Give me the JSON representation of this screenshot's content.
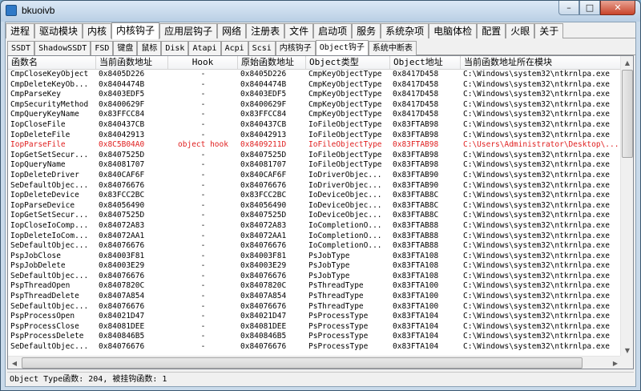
{
  "window": {
    "title": "bkuoivb",
    "minimize": "–",
    "maximize": "□",
    "close": "✕"
  },
  "main_tabs": [
    {
      "label": "进程",
      "active": false
    },
    {
      "label": "驱动模块",
      "active": false
    },
    {
      "label": "内核",
      "active": false
    },
    {
      "label": "内核钩子",
      "active": true
    },
    {
      "label": "应用层钩子",
      "active": false
    },
    {
      "label": "网络",
      "active": false
    },
    {
      "label": "注册表",
      "active": false
    },
    {
      "label": "文件",
      "active": false
    },
    {
      "label": "启动项",
      "active": false
    },
    {
      "label": "服务",
      "active": false
    },
    {
      "label": "系统杂项",
      "active": false
    },
    {
      "label": "电脑体检",
      "active": false
    },
    {
      "label": "配置",
      "active": false
    },
    {
      "label": "火眼",
      "active": false
    },
    {
      "label": "关于",
      "active": false
    }
  ],
  "sub_tabs": [
    {
      "label": "SSDT",
      "active": false
    },
    {
      "label": "ShadowSSDT",
      "active": false
    },
    {
      "label": "FSD",
      "active": false
    },
    {
      "label": "键盘",
      "active": false
    },
    {
      "label": "鼠标",
      "active": false
    },
    {
      "label": "Disk",
      "active": false
    },
    {
      "label": "Atapi",
      "active": false
    },
    {
      "label": "Acpi",
      "active": false
    },
    {
      "label": "Scsi",
      "active": false
    },
    {
      "label": "内核钩子",
      "active": false
    },
    {
      "label": "Object钩子",
      "active": true
    },
    {
      "label": "系统中断表",
      "active": false
    }
  ],
  "columns": [
    "函数名",
    "当前函数地址",
    "Hook",
    "原始函数地址",
    "Object类型",
    "Object地址",
    "当前函数地址所在模块"
  ],
  "rows": [
    {
      "name": "CmpCloseKeyObject",
      "cur": "0x8405D226",
      "hook": "-",
      "orig": "0x8405D226",
      "type": "CmpKeyObjectType",
      "addr": "0x8417D458",
      "module": "C:\\Windows\\system32\\ntkrnlpa.exe",
      "hooked": false
    },
    {
      "name": "CmpDeleteKeyOb...",
      "cur": "0x8404474B",
      "hook": "-",
      "orig": "0x8404474B",
      "type": "CmpKeyObjectType",
      "addr": "0x8417D458",
      "module": "C:\\Windows\\system32\\ntkrnlpa.exe",
      "hooked": false
    },
    {
      "name": "CmpParseKey",
      "cur": "0x8403EDF5",
      "hook": "-",
      "orig": "0x8403EDF5",
      "type": "CmpKeyObjectType",
      "addr": "0x8417D458",
      "module": "C:\\Windows\\system32\\ntkrnlpa.exe",
      "hooked": false
    },
    {
      "name": "CmpSecurityMethod",
      "cur": "0x8400629F",
      "hook": "-",
      "orig": "0x8400629F",
      "type": "CmpKeyObjectType",
      "addr": "0x8417D458",
      "module": "C:\\Windows\\system32\\ntkrnlpa.exe",
      "hooked": false
    },
    {
      "name": "CmpQueryKeyName",
      "cur": "0x83FFCC84",
      "hook": "-",
      "orig": "0x83FFCC84",
      "type": "CmpKeyObjectType",
      "addr": "0x8417D458",
      "module": "C:\\Windows\\system32\\ntkrnlpa.exe",
      "hooked": false
    },
    {
      "name": "IopCloseFile",
      "cur": "0x840437CB",
      "hook": "-",
      "orig": "0x840437CB",
      "type": "IoFileObjectType",
      "addr": "0x83FTAB98",
      "module": "C:\\Windows\\system32\\ntkrnlpa.exe",
      "hooked": false
    },
    {
      "name": "IopDeleteFile",
      "cur": "0x84042913",
      "hook": "-",
      "orig": "0x84042913",
      "type": "IoFileObjectType",
      "addr": "0x83FTAB98",
      "module": "C:\\Windows\\system32\\ntkrnlpa.exe",
      "hooked": false
    },
    {
      "name": "IopParseFile",
      "cur": "0x8C5B04A0",
      "hook": "object hook",
      "orig": "0x8409211D",
      "type": "IoFileObjectType",
      "addr": "0x83FTAB98",
      "module": "C:\\Users\\Administrator\\Desktop\\...",
      "hooked": true
    },
    {
      "name": "IopGetSetSecur...",
      "cur": "0x8407525D",
      "hook": "-",
      "orig": "0x8407525D",
      "type": "IoFileObjectType",
      "addr": "0x83FTAB98",
      "module": "C:\\Windows\\system32\\ntkrnlpa.exe",
      "hooked": false
    },
    {
      "name": "IopQueryName",
      "cur": "0x84081707",
      "hook": "-",
      "orig": "0x84081707",
      "type": "IoFileObjectType",
      "addr": "0x83FTAB98",
      "module": "C:\\Windows\\system32\\ntkrnlpa.exe",
      "hooked": false
    },
    {
      "name": "IopDeleteDriver",
      "cur": "0x840CAF6F",
      "hook": "-",
      "orig": "0x840CAF6F",
      "type": "IoDriverObjec...",
      "addr": "0x83FTAB90",
      "module": "C:\\Windows\\system32\\ntkrnlpa.exe",
      "hooked": false
    },
    {
      "name": "SeDefaultObjec...",
      "cur": "0x84076676",
      "hook": "-",
      "orig": "0x84076676",
      "type": "IoDriverObjec...",
      "addr": "0x83FTAB90",
      "module": "C:\\Windows\\system32\\ntkrnlpa.exe",
      "hooked": false
    },
    {
      "name": "IopDeleteDevice",
      "cur": "0x83FCC2BC",
      "hook": "-",
      "orig": "0x83FCC2BC",
      "type": "IoDeviceObjec...",
      "addr": "0x83FTAB8C",
      "module": "C:\\Windows\\system32\\ntkrnlpa.exe",
      "hooked": false
    },
    {
      "name": "IopParseDevice",
      "cur": "0x84056490",
      "hook": "-",
      "orig": "0x84056490",
      "type": "IoDeviceObjec...",
      "addr": "0x83FTAB8C",
      "module": "C:\\Windows\\system32\\ntkrnlpa.exe",
      "hooked": false
    },
    {
      "name": "IopGetSetSecur...",
      "cur": "0x8407525D",
      "hook": "-",
      "orig": "0x8407525D",
      "type": "IoDeviceObjec...",
      "addr": "0x83FTAB8C",
      "module": "C:\\Windows\\system32\\ntkrnlpa.exe",
      "hooked": false
    },
    {
      "name": "IopCloseIoComp...",
      "cur": "0x84072A83",
      "hook": "-",
      "orig": "0x84072A83",
      "type": "IoCompletionO...",
      "addr": "0x83FTAB88",
      "module": "C:\\Windows\\system32\\ntkrnlpa.exe",
      "hooked": false
    },
    {
      "name": "IopDeleteIoCom...",
      "cur": "0x84072AA1",
      "hook": "-",
      "orig": "0x84072AA1",
      "type": "IoCompletionO...",
      "addr": "0x83FTAB88",
      "module": "C:\\Windows\\system32\\ntkrnlpa.exe",
      "hooked": false
    },
    {
      "name": "SeDefaultObjec...",
      "cur": "0x84076676",
      "hook": "-",
      "orig": "0x84076676",
      "type": "IoCompletionO...",
      "addr": "0x83FTAB88",
      "module": "C:\\Windows\\system32\\ntkrnlpa.exe",
      "hooked": false
    },
    {
      "name": "PspJobClose",
      "cur": "0x84003F81",
      "hook": "-",
      "orig": "0x84003F81",
      "type": "PsJobType",
      "addr": "0x83FTA108",
      "module": "C:\\Windows\\system32\\ntkrnlpa.exe",
      "hooked": false
    },
    {
      "name": "PspJobDelete",
      "cur": "0x84003E29",
      "hook": "-",
      "orig": "0x84003E29",
      "type": "PsJobType",
      "addr": "0x83FTA108",
      "module": "C:\\Windows\\system32\\ntkrnlpa.exe",
      "hooked": false
    },
    {
      "name": "SeDefaultObjec...",
      "cur": "0x84076676",
      "hook": "-",
      "orig": "0x84076676",
      "type": "PsJobType",
      "addr": "0x83FTA108",
      "module": "C:\\Windows\\system32\\ntkrnlpa.exe",
      "hooked": false
    },
    {
      "name": "PspThreadOpen",
      "cur": "0x8407820C",
      "hook": "-",
      "orig": "0x8407820C",
      "type": "PsThreadType",
      "addr": "0x83FTA100",
      "module": "C:\\Windows\\system32\\ntkrnlpa.exe",
      "hooked": false
    },
    {
      "name": "PspThreadDelete",
      "cur": "0x8407A854",
      "hook": "-",
      "orig": "0x8407A854",
      "type": "PsThreadType",
      "addr": "0x83FTA100",
      "module": "C:\\Windows\\system32\\ntkrnlpa.exe",
      "hooked": false
    },
    {
      "name": "SeDefaultObjec...",
      "cur": "0x84076676",
      "hook": "-",
      "orig": "0x84076676",
      "type": "PsThreadType",
      "addr": "0x83FTA100",
      "module": "C:\\Windows\\system32\\ntkrnlpa.exe",
      "hooked": false
    },
    {
      "name": "PspProcessOpen",
      "cur": "0x84021D47",
      "hook": "-",
      "orig": "0x84021D47",
      "type": "PsProcessType",
      "addr": "0x83FTA104",
      "module": "C:\\Windows\\system32\\ntkrnlpa.exe",
      "hooked": false
    },
    {
      "name": "PspProcessClose",
      "cur": "0x84081DEE",
      "hook": "-",
      "orig": "0x84081DEE",
      "type": "PsProcessType",
      "addr": "0x83FTA104",
      "module": "C:\\Windows\\system32\\ntkrnlpa.exe",
      "hooked": false
    },
    {
      "name": "PspProcessDelete",
      "cur": "0x840846B5",
      "hook": "-",
      "orig": "0x840846B5",
      "type": "PsProcessType",
      "addr": "0x83FTA104",
      "module": "C:\\Windows\\system32\\ntkrnlpa.exe",
      "hooked": false
    },
    {
      "name": "SeDefaultObjec...",
      "cur": "0x84076676",
      "hook": "-",
      "orig": "0x84076676",
      "type": "PsProcessType",
      "addr": "0x83FTA104",
      "module": "C:\\Windows\\system32\\ntkrnlpa.exe",
      "hooked": false
    }
  ],
  "status": "Object Type函数:  204,  被挂钩函数:  1",
  "colors": {
    "hooked_text": "#e02020",
    "window_frame": "#c9daea"
  }
}
